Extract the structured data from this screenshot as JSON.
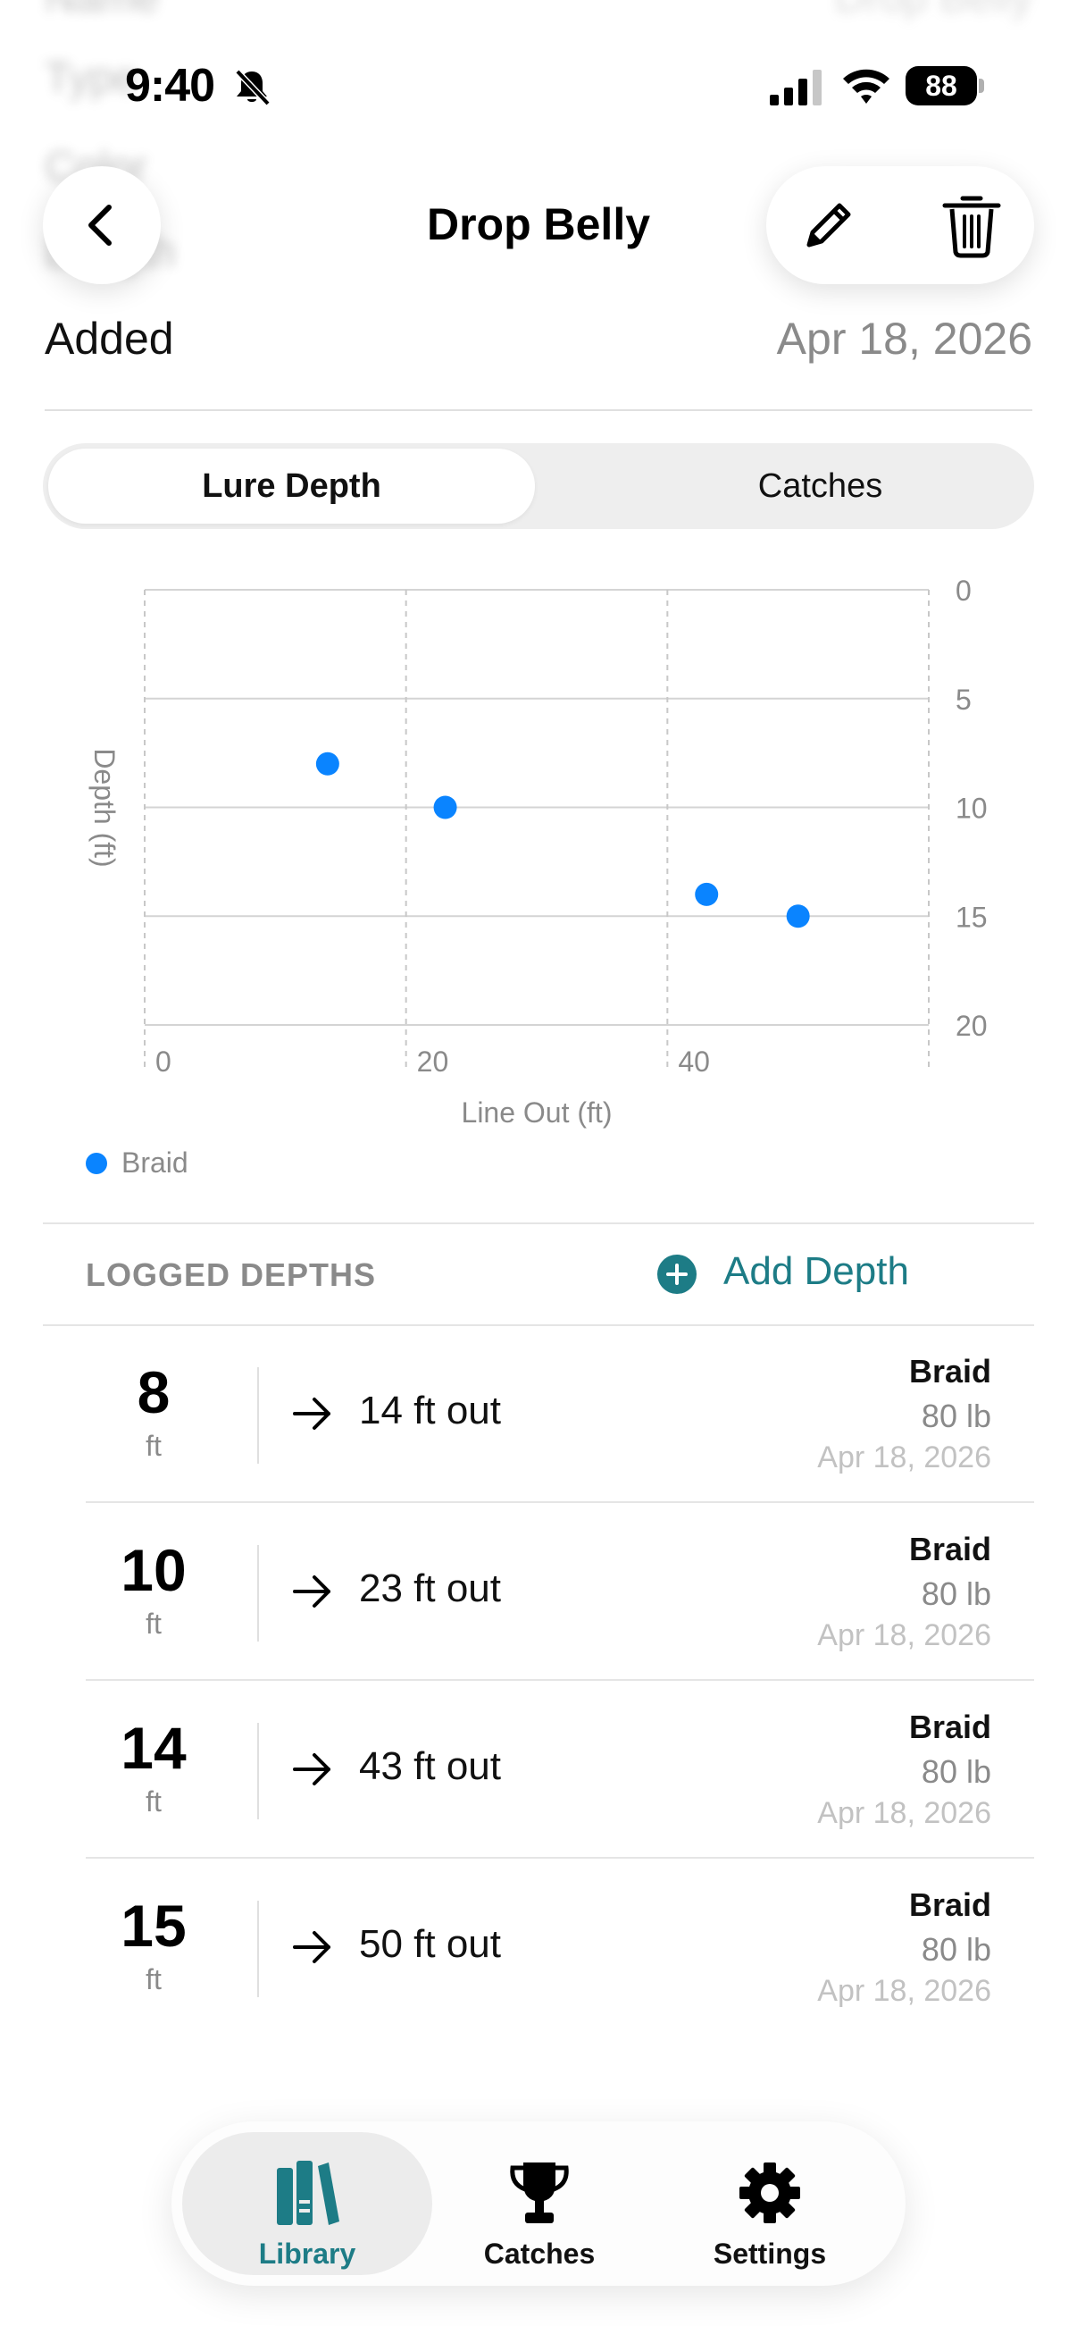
{
  "status_bar": {
    "time": "9:40",
    "battery": "88"
  },
  "header": {
    "title": "Drop Belly"
  },
  "background_rows": [
    {
      "label": "Name",
      "value": "Drop Belly"
    },
    {
      "label": "Type",
      "value": ""
    },
    {
      "label": "Color",
      "value": ""
    },
    {
      "label": "Length",
      "value": ""
    }
  ],
  "added": {
    "label": "Added",
    "value": "Apr 18, 2026"
  },
  "segmented": {
    "tabs": [
      "Lure Depth",
      "Catches"
    ],
    "active": 0
  },
  "chart_data": {
    "type": "scatter",
    "xlabel": "Line Out (ft)",
    "ylabel": "Depth (ft)",
    "xlim": [
      0,
      60
    ],
    "ylim": [
      0,
      20
    ],
    "y_inverted": true,
    "x_ticks": [
      0,
      20,
      40
    ],
    "y_ticks": [
      0,
      5,
      10,
      15,
      20
    ],
    "grid": true,
    "legend_position": "bottom-left",
    "series": [
      {
        "name": "Braid",
        "color": "#0a84ff",
        "points": [
          {
            "x": 14,
            "y": 8
          },
          {
            "x": 23,
            "y": 10
          },
          {
            "x": 43,
            "y": 14
          },
          {
            "x": 50,
            "y": 15
          }
        ]
      }
    ]
  },
  "logged": {
    "title": "LOGGED DEPTHS",
    "add_label": "Add Depth",
    "rows": [
      {
        "depth": "8",
        "unit": "ft",
        "out": "14 ft out",
        "line": "Braid",
        "lb": "80 lb",
        "date": "Apr 18, 2026"
      },
      {
        "depth": "10",
        "unit": "ft",
        "out": "23 ft out",
        "line": "Braid",
        "lb": "80 lb",
        "date": "Apr 18, 2026"
      },
      {
        "depth": "14",
        "unit": "ft",
        "out": "43 ft out",
        "line": "Braid",
        "lb": "80 lb",
        "date": "Apr 18, 2026"
      },
      {
        "depth": "15",
        "unit": "ft",
        "out": "50 ft out",
        "line": "Braid",
        "lb": "80 lb",
        "date": "Apr 18, 2026"
      }
    ]
  },
  "tabbar": {
    "tabs": [
      {
        "label": "Library",
        "icon": "books-icon",
        "active": true
      },
      {
        "label": "Catches",
        "icon": "trophy-icon",
        "active": false
      },
      {
        "label": "Settings",
        "icon": "gear-icon",
        "active": false
      }
    ]
  },
  "colors": {
    "accent": "#1d7c86",
    "series": "#0a84ff"
  }
}
